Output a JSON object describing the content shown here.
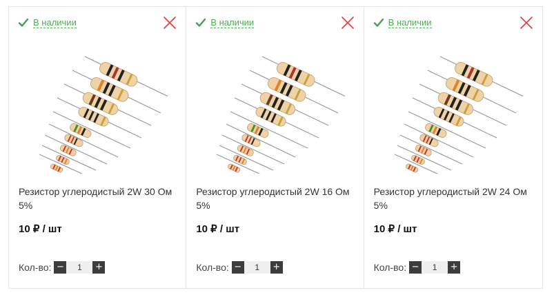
{
  "colors": {
    "stock_green": "#4caf50",
    "close_red": "#e53935",
    "qty_button": "#3c3c3c"
  },
  "cards": [
    {
      "stock": "В наличии",
      "title": "Резистор углеродистый 2W 30 Ом 5%",
      "price": "10 ₽ / шт",
      "qty_label": "Кол-во:",
      "qty_minus": "−",
      "qty_plus": "+",
      "qty_value": "1"
    },
    {
      "stock": "В наличии",
      "title": "Резистор углеродистый 2W 16 Ом 5%",
      "price": "10 ₽ / шт",
      "qty_label": "Кол-во:",
      "qty_minus": "−",
      "qty_plus": "+",
      "qty_value": "1"
    },
    {
      "stock": "В наличии",
      "title": "Резистор углеродистый 2W 24 Ом 5%",
      "price": "10 ₽ / шт",
      "qty_label": "Кол-во:",
      "qty_minus": "−",
      "qty_plus": "+",
      "qty_value": "1"
    }
  ]
}
